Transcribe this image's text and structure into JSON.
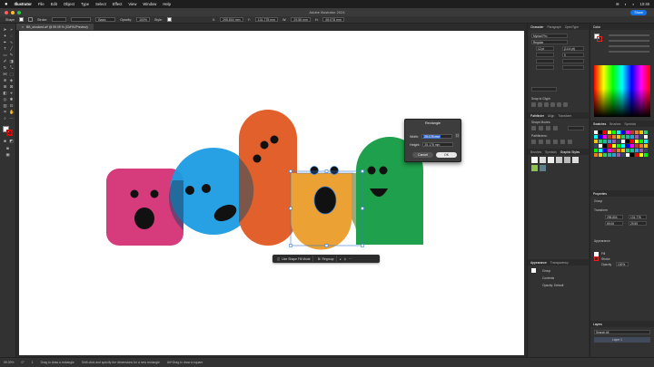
{
  "menubar": {
    "app_name": "Illustrator",
    "items": [
      "File",
      "Edit",
      "Object",
      "Type",
      "Select",
      "Effect",
      "View",
      "Window",
      "Help"
    ],
    "status_right": [
      "☰",
      "◐",
      "⌕",
      "10:48"
    ]
  },
  "window": {
    "title": "Adobe Illustrator 2024",
    "share_label": "Share"
  },
  "control_bar": {
    "selection_label": "Shape",
    "stroke_label": "Stroke:",
    "style_label": "Basic",
    "opacity_label": "Opacity:",
    "opacity_value": "100%",
    "style_name_label": "Style:",
    "x_value": "295.804 mm",
    "y_value": "131.778 mm",
    "w_value": "29.55 mm",
    "h_value": "69.078 mm"
  },
  "document": {
    "tab_label": "BB_shocked.ai* @ 59.09 % (CMYK/Preview)"
  },
  "dialog": {
    "title": "Rectangle",
    "width_label": "Width:",
    "width_value": "25.178 mm",
    "height_label": "Height:",
    "height_value": "25.178 mm",
    "cancel_label": "Cancel",
    "ok_label": "OK"
  },
  "taskbar": {
    "action1": "Use Shape Fill Mode",
    "action2": "Regroup",
    "more": "···"
  },
  "status_bar": {
    "zoom": "59.09%",
    "angle": "0°",
    "page": "1",
    "hint": "Drag to draw a rectangle",
    "hint2": "Shift-click and specify the dimensions for a new rectangle",
    "hint3": "Alt+Drag to draw a square"
  },
  "panel_left": {
    "tabs": [
      "Character",
      "Paragraph",
      "OpenType"
    ],
    "font_family": "Myriad Pro",
    "font_style": "Regular",
    "font_size": "12 pt",
    "leading": "(14.4 pt)",
    "tracking": "0",
    "section_snap": "Snap to Glyph",
    "tabs2": [
      "Pathfinder",
      "Align",
      "Transform"
    ],
    "shape_modes": "Shape Modes:",
    "pathfinders": "Pathfinders:",
    "tabs3": [
      "Brushes",
      "Symbols",
      "Graphic Styles"
    ],
    "tabs4": [
      "Appearance",
      "Transparency"
    ],
    "appearance_item": "Group",
    "contents": "Contents",
    "opacity": "Opacity: Default"
  },
  "panel_right": {
    "color_tab": "Color",
    "swatches_tabs": [
      "Swatches",
      "Brushes",
      "Symbols"
    ],
    "properties_tab": "Properties",
    "group_label": "Group",
    "transform_label": "Transform",
    "x": "295.804",
    "y": "131.778",
    "w": "69.06",
    "h": "29.55",
    "appearance_label": "Appearance",
    "fill_label": "Fill",
    "stroke_label": "Stroke",
    "opacity_label": "Opacity",
    "opacity_value": "100%",
    "layers_tab": "Layers",
    "layer_name": "Layer 1",
    "search": "Search All"
  },
  "colors": {
    "pink": "#d63b7c",
    "blue": "#1b9ce2",
    "orange": "#e1602c",
    "yellow": "#eba134",
    "green": "#1fa04c",
    "selection": "#3a7bd5"
  }
}
